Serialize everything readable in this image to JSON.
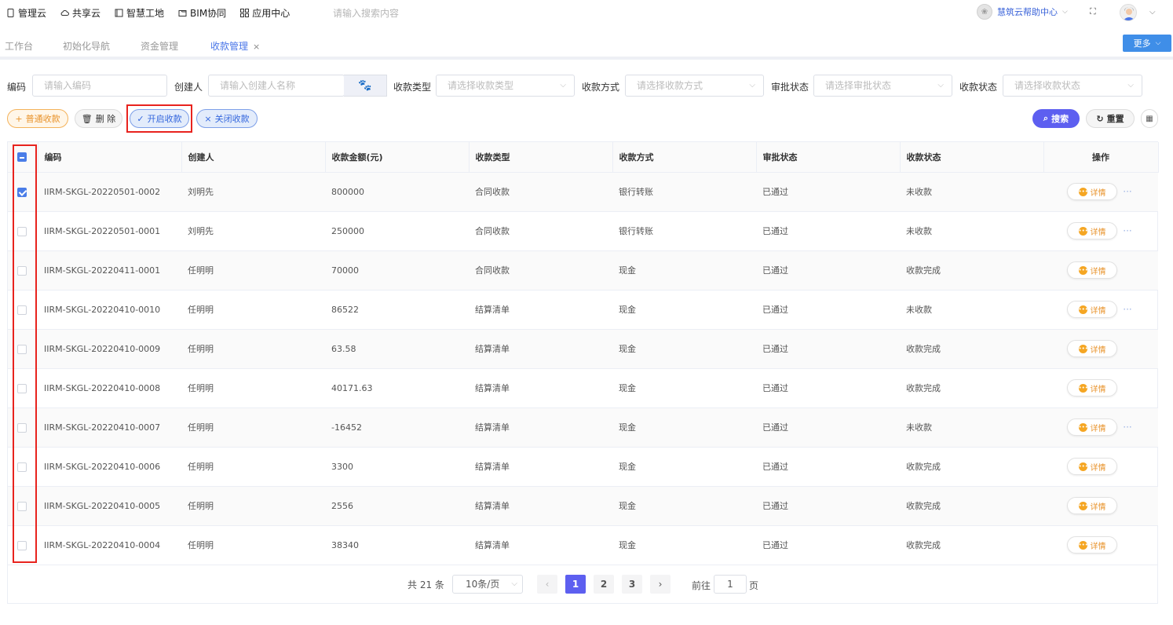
{
  "topnav": {
    "items": [
      {
        "label": "管理云",
        "icon": "phone-icon"
      },
      {
        "label": "共享云",
        "icon": "cloud-icon"
      },
      {
        "label": "智慧工地",
        "icon": "book-icon"
      },
      {
        "label": "BIM协同",
        "icon": "folder-icon"
      },
      {
        "label": "应用中心",
        "icon": "apps-grid-icon"
      }
    ],
    "search_placeholder": "请输入搜索内容",
    "help_label": "慧筑云帮助中心"
  },
  "tabs": [
    {
      "label": "工作台"
    },
    {
      "label": "初始化导航"
    },
    {
      "label": "资金管理"
    },
    {
      "label": "收款管理",
      "active": true
    }
  ],
  "more_label": "更多",
  "filters": {
    "code_label": "编码",
    "code_placeholder": "请输入编码",
    "creator_label": "创建人",
    "creator_placeholder": "请输入创建人名称",
    "type_label": "收款类型",
    "type_placeholder": "请选择收款类型",
    "method_label": "收款方式",
    "method_placeholder": "请选择收款方式",
    "approval_label": "审批状态",
    "approval_placeholder": "请选择审批状态",
    "status_label": "收款状态",
    "status_placeholder": "请选择收款状态"
  },
  "toolbar": {
    "add_label": "普通收款",
    "delete_label": "删 除",
    "open_label": "开启收款",
    "close_label": "关闭收款",
    "search_label": "搜索",
    "reset_label": "重置"
  },
  "table": {
    "headers": [
      "编码",
      "创建人",
      "收款金额(元)",
      "收款类型",
      "收款方式",
      "审批状态",
      "收款状态",
      "操作"
    ],
    "detail_label": "详情",
    "rows": [
      {
        "code": "IIRM-SKGL-20220501-0002",
        "creator": "刘明先",
        "amount": "800000",
        "type": "合同收款",
        "method": "银行转账",
        "approval": "已通过",
        "status": "未收款",
        "checked": true,
        "more": true
      },
      {
        "code": "IIRM-SKGL-20220501-0001",
        "creator": "刘明先",
        "amount": "250000",
        "type": "合同收款",
        "method": "银行转账",
        "approval": "已通过",
        "status": "未收款",
        "checked": false,
        "more": true
      },
      {
        "code": "IIRM-SKGL-20220411-0001",
        "creator": "任明明",
        "amount": "70000",
        "type": "合同收款",
        "method": "现金",
        "approval": "已通过",
        "status": "收款完成",
        "checked": false,
        "more": false
      },
      {
        "code": "IIRM-SKGL-20220410-0010",
        "creator": "任明明",
        "amount": "86522",
        "type": "结算清单",
        "method": "现金",
        "approval": "已通过",
        "status": "未收款",
        "checked": false,
        "more": true
      },
      {
        "code": "IIRM-SKGL-20220410-0009",
        "creator": "任明明",
        "amount": "63.58",
        "type": "结算清单",
        "method": "现金",
        "approval": "已通过",
        "status": "收款完成",
        "checked": false,
        "more": false
      },
      {
        "code": "IIRM-SKGL-20220410-0008",
        "creator": "任明明",
        "amount": "40171.63",
        "type": "结算清单",
        "method": "现金",
        "approval": "已通过",
        "status": "收款完成",
        "checked": false,
        "more": false
      },
      {
        "code": "IIRM-SKGL-20220410-0007",
        "creator": "任明明",
        "amount": "-16452",
        "type": "结算清单",
        "method": "现金",
        "approval": "已通过",
        "status": "未收款",
        "checked": false,
        "more": true
      },
      {
        "code": "IIRM-SKGL-20220410-0006",
        "creator": "任明明",
        "amount": "3300",
        "type": "结算清单",
        "method": "现金",
        "approval": "已通过",
        "status": "收款完成",
        "checked": false,
        "more": false
      },
      {
        "code": "IIRM-SKGL-20220410-0005",
        "creator": "任明明",
        "amount": "2556",
        "type": "结算清单",
        "method": "现金",
        "approval": "已通过",
        "status": "收款完成",
        "checked": false,
        "more": false
      },
      {
        "code": "IIRM-SKGL-20220410-0004",
        "creator": "任明明",
        "amount": "38340",
        "type": "结算清单",
        "method": "现金",
        "approval": "已通过",
        "status": "收款完成",
        "checked": false,
        "more": false
      }
    ]
  },
  "pagination": {
    "total_label": "共 21 条",
    "page_size": "10条/页",
    "pages": [
      "1",
      "2",
      "3"
    ],
    "current_page": "1",
    "goto_label": "前往",
    "goto_value": "1",
    "page_suffix": "页"
  },
  "colors": {
    "accent": "#5d5ff0",
    "primary_blue": "#3f8ee8",
    "orange": "#e8922a",
    "highlight_red": "#e8231e"
  }
}
